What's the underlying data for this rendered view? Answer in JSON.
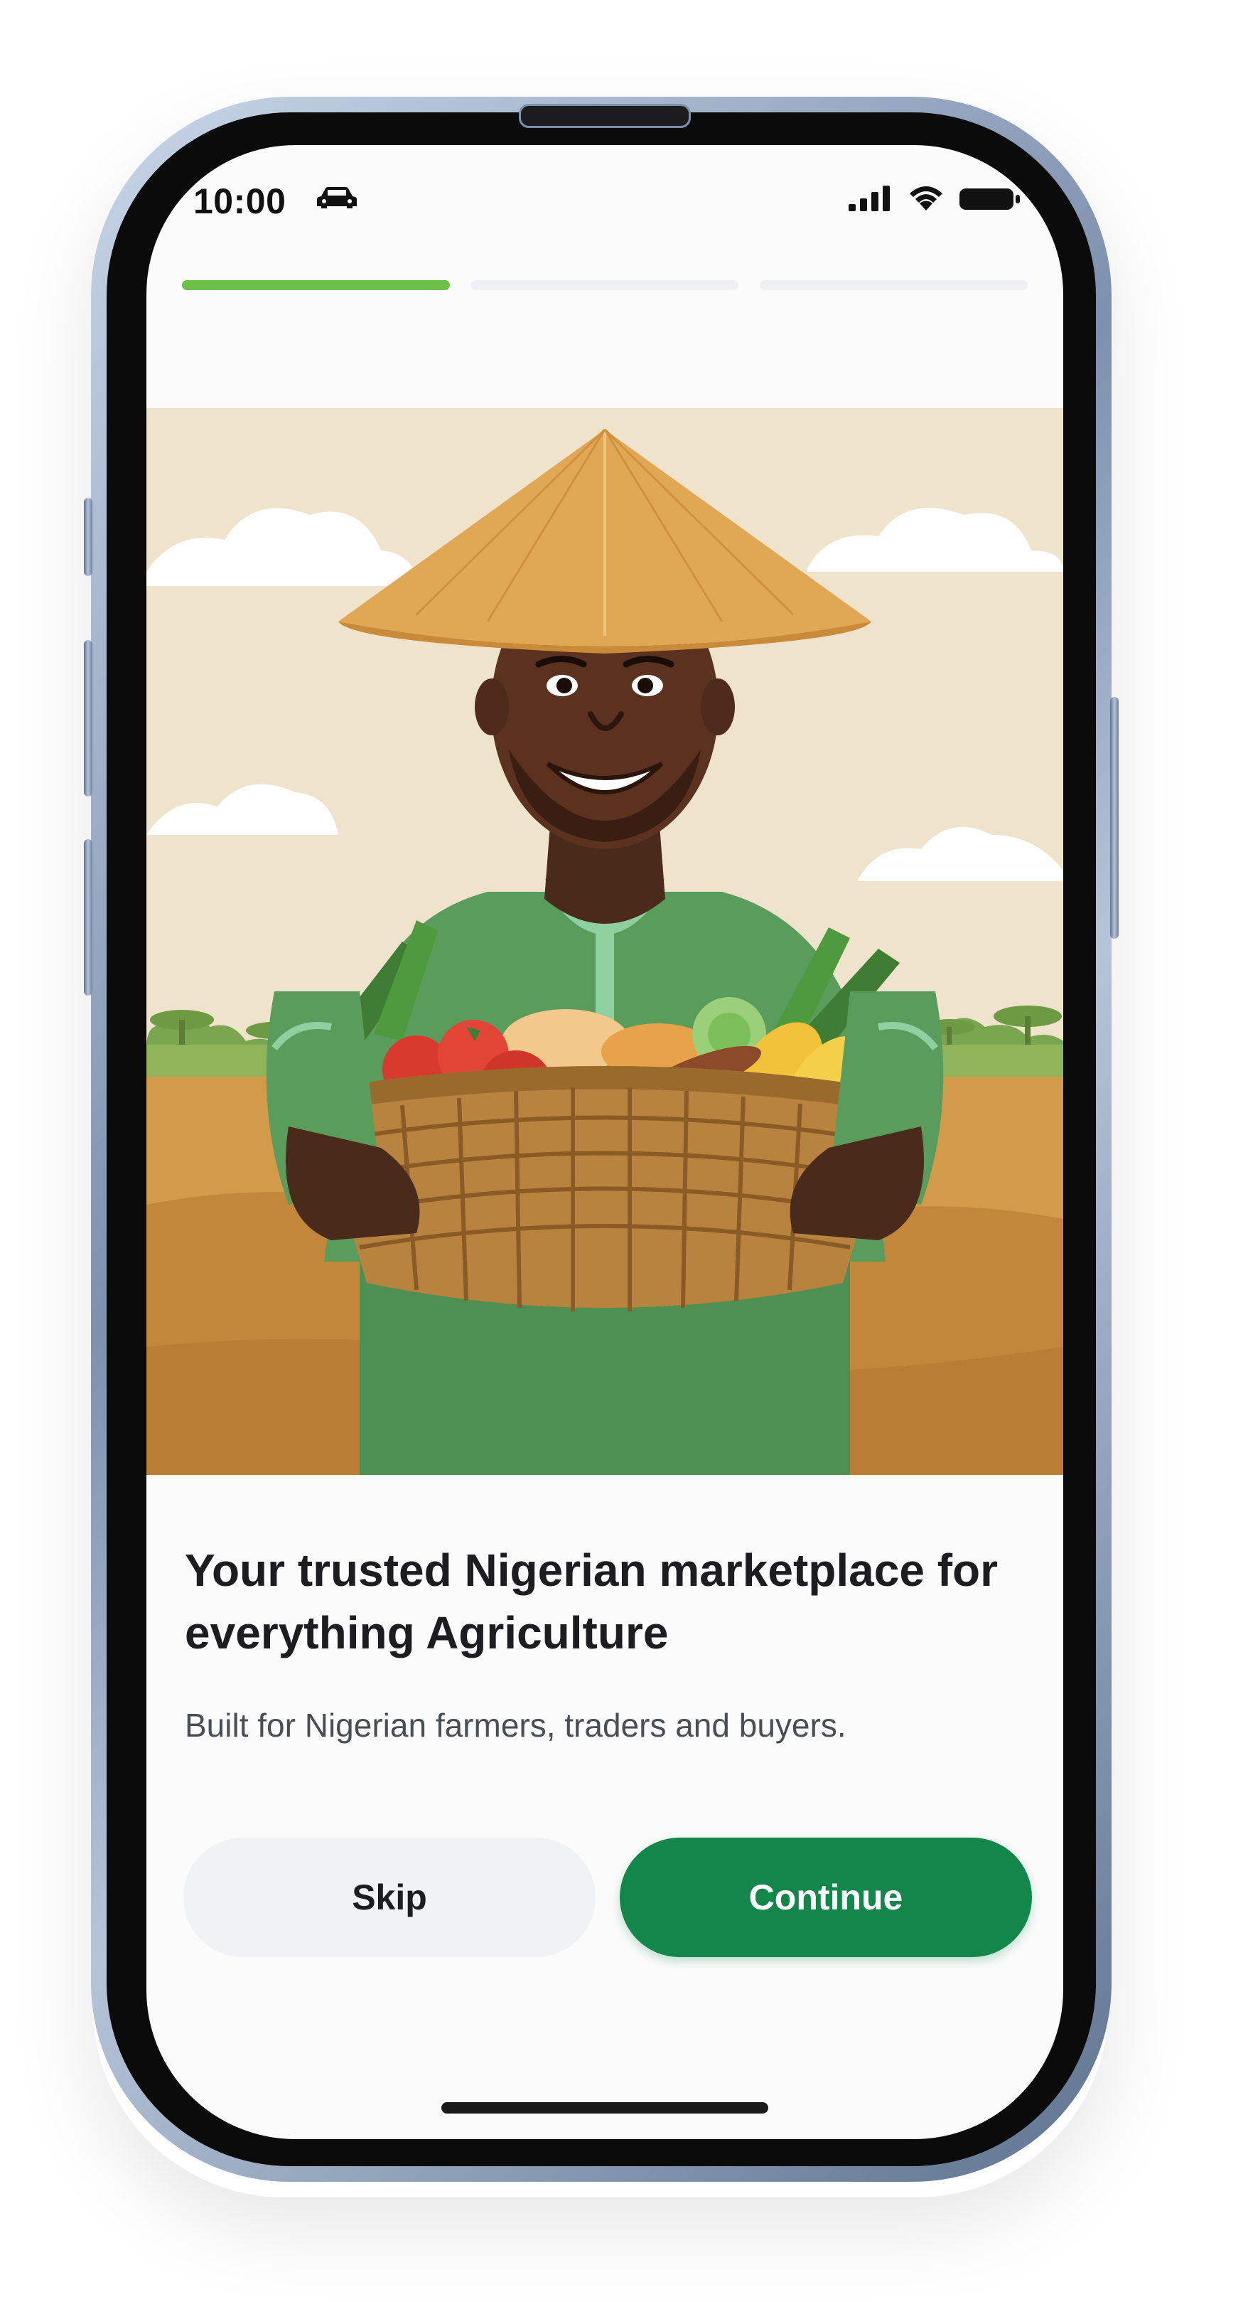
{
  "status_bar": {
    "time": "10:00",
    "car_icon": "car-icon",
    "signal_icon": "cellular-signal-icon",
    "wifi_icon": "wifi-icon",
    "battery_icon": "battery-icon"
  },
  "onboarding": {
    "progress_steps": 3,
    "current_step": 1,
    "illustration": "farmer-with-produce-basket",
    "headline": "Your trusted Nigerian marketplace for everything Agriculture",
    "subtext": "Built for Nigerian farmers, traders and buyers.",
    "skip_label": "Skip",
    "continue_label": "Continue"
  },
  "colors": {
    "accent_green": "#13874a",
    "progress_active": "#6cc04a",
    "progress_inactive": "#eef0f3",
    "skip_bg": "#f1f2f4"
  }
}
